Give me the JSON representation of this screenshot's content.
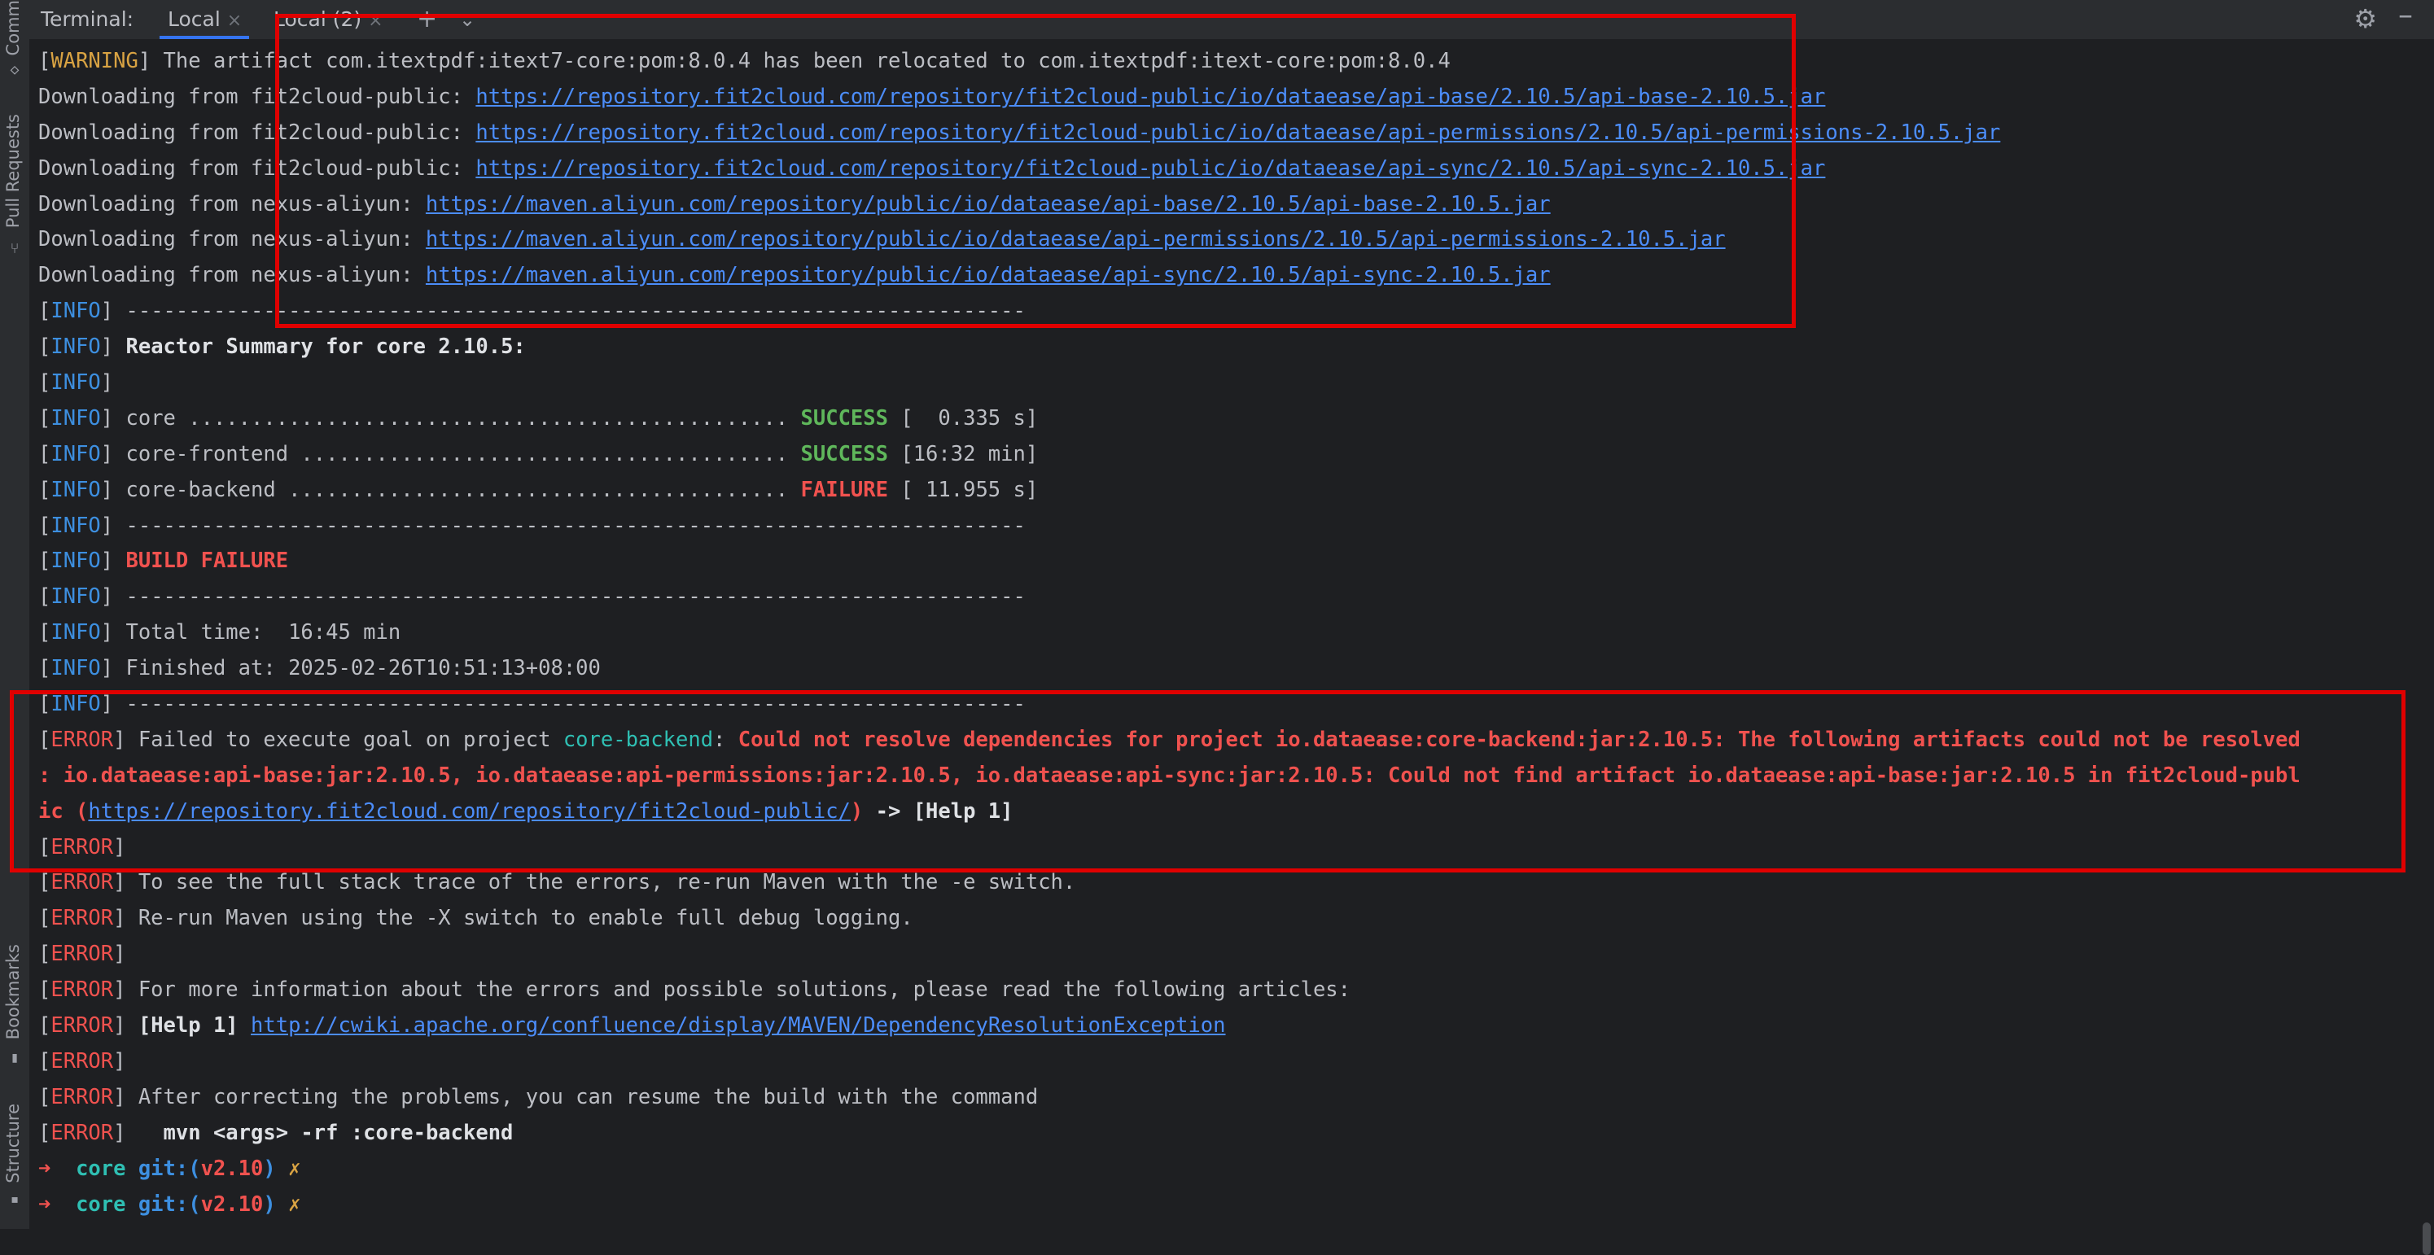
{
  "tabbar": {
    "label": "Terminal:",
    "tabs": [
      {
        "label": "Local",
        "active": true
      },
      {
        "label": "Local (2)",
        "active": false
      }
    ],
    "add_icon": "plus-icon",
    "menu_icon": "chevron-down-icon",
    "settings_icon": "gear-icon",
    "hide_icon": "minus-icon"
  },
  "left_strip": {
    "commit": "Comm",
    "pull_requests": "Pull Requests",
    "bookmarks": "Bookmarks",
    "structure": "Structure"
  },
  "terminal": {
    "lines": [
      [
        {
          "t": "[",
          "c": ""
        },
        {
          "t": "WARNING",
          "c": "c-warn"
        },
        {
          "t": "] The artifact com.itextpdf:itext7-core:pom:8.0.4 has been relocated to com.itextpdf:itext-core:pom:8.0.4",
          "c": ""
        }
      ],
      [
        {
          "t": "Downloading from fit2cloud-public: ",
          "c": ""
        },
        {
          "t": "https://repository.fit2cloud.com/repository/fit2cloud-public/io/dataease/api-base/2.10.5/api-base-2.10.5.jar",
          "c": "link"
        }
      ],
      [
        {
          "t": "Downloading from fit2cloud-public: ",
          "c": ""
        },
        {
          "t": "https://repository.fit2cloud.com/repository/fit2cloud-public/io/dataease/api-permissions/2.10.5/api-permissions-2.10.5.jar",
          "c": "link"
        }
      ],
      [
        {
          "t": "Downloading from fit2cloud-public: ",
          "c": ""
        },
        {
          "t": "https://repository.fit2cloud.com/repository/fit2cloud-public/io/dataease/api-sync/2.10.5/api-sync-2.10.5.jar",
          "c": "link"
        }
      ],
      [
        {
          "t": "Downloading from nexus-aliyun: ",
          "c": ""
        },
        {
          "t": "https://maven.aliyun.com/repository/public/io/dataease/api-base/2.10.5/api-base-2.10.5.jar",
          "c": "link"
        }
      ],
      [
        {
          "t": "Downloading from nexus-aliyun: ",
          "c": ""
        },
        {
          "t": "https://maven.aliyun.com/repository/public/io/dataease/api-permissions/2.10.5/api-permissions-2.10.5.jar",
          "c": "link"
        }
      ],
      [
        {
          "t": "Downloading from nexus-aliyun: ",
          "c": ""
        },
        {
          "t": "https://maven.aliyun.com/repository/public/io/dataease/api-sync/2.10.5/api-sync-2.10.5.jar",
          "c": "link"
        }
      ],
      [
        {
          "t": "[",
          "c": ""
        },
        {
          "t": "INFO",
          "c": "c-info"
        },
        {
          "t": "] ------------------------------------------------------------------------",
          "c": ""
        }
      ],
      [
        {
          "t": "[",
          "c": ""
        },
        {
          "t": "INFO",
          "c": "c-info"
        },
        {
          "t": "] ",
          "c": ""
        },
        {
          "t": "Reactor Summary for core 2.10.5:",
          "c": "c-bold"
        }
      ],
      [
        {
          "t": "[",
          "c": ""
        },
        {
          "t": "INFO",
          "c": "c-info"
        },
        {
          "t": "]",
          "c": ""
        }
      ],
      [
        {
          "t": "[",
          "c": ""
        },
        {
          "t": "INFO",
          "c": "c-info"
        },
        {
          "t": "] core ................................................ ",
          "c": ""
        },
        {
          "t": "SUCCESS",
          "c": "c-succ"
        },
        {
          "t": " [  0.335 s]",
          "c": ""
        }
      ],
      [
        {
          "t": "[",
          "c": ""
        },
        {
          "t": "INFO",
          "c": "c-info"
        },
        {
          "t": "] core-frontend ....................................... ",
          "c": ""
        },
        {
          "t": "SUCCESS",
          "c": "c-succ"
        },
        {
          "t": " [16:32 min]",
          "c": ""
        }
      ],
      [
        {
          "t": "[",
          "c": ""
        },
        {
          "t": "INFO",
          "c": "c-info"
        },
        {
          "t": "] core-backend ........................................ ",
          "c": ""
        },
        {
          "t": "FAILURE",
          "c": "c-fail"
        },
        {
          "t": " [ 11.955 s]",
          "c": ""
        }
      ],
      [
        {
          "t": "[",
          "c": ""
        },
        {
          "t": "INFO",
          "c": "c-info"
        },
        {
          "t": "] ------------------------------------------------------------------------",
          "c": ""
        }
      ],
      [
        {
          "t": "[",
          "c": ""
        },
        {
          "t": "INFO",
          "c": "c-info"
        },
        {
          "t": "] ",
          "c": ""
        },
        {
          "t": "BUILD FAILURE",
          "c": "c-errbold"
        }
      ],
      [
        {
          "t": "[",
          "c": ""
        },
        {
          "t": "INFO",
          "c": "c-info"
        },
        {
          "t": "] ------------------------------------------------------------------------",
          "c": ""
        }
      ],
      [
        {
          "t": "[",
          "c": ""
        },
        {
          "t": "INFO",
          "c": "c-info"
        },
        {
          "t": "] Total time:  16:45 min",
          "c": ""
        }
      ],
      [
        {
          "t": "[",
          "c": ""
        },
        {
          "t": "INFO",
          "c": "c-info"
        },
        {
          "t": "] Finished at: 2025-02-26T10:51:13+08:00",
          "c": ""
        }
      ],
      [
        {
          "t": "[",
          "c": ""
        },
        {
          "t": "INFO",
          "c": "c-info"
        },
        {
          "t": "] ------------------------------------------------------------------------",
          "c": ""
        }
      ],
      [
        {
          "t": "[",
          "c": ""
        },
        {
          "t": "ERROR",
          "c": "c-err"
        },
        {
          "t": "] Failed to execute goal on project ",
          "c": ""
        },
        {
          "t": "core-backend",
          "c": "c-mod"
        },
        {
          "t": ": ",
          "c": ""
        },
        {
          "t": "Could not resolve dependencies for project io.dataease:core-backend:jar:2.10.5: The following artifacts could not be resolved",
          "c": "c-errbold"
        }
      ],
      [
        {
          "t": ": io.dataease:api-base:jar:2.10.5, io.dataease:api-permissions:jar:2.10.5, io.dataease:api-sync:jar:2.10.5: Could not find artifact io.dataease:api-base:jar:2.10.5 in fit2cloud-publ",
          "c": "c-errbold"
        }
      ],
      [
        {
          "t": "ic (",
          "c": "c-errbold"
        },
        {
          "t": "https://repository.fit2cloud.com/repository/fit2cloud-public/",
          "c": "link"
        },
        {
          "t": ")",
          "c": "c-errbold"
        },
        {
          "t": " -> [Help 1]",
          "c": "c-bold"
        }
      ],
      [
        {
          "t": "[",
          "c": ""
        },
        {
          "t": "ERROR",
          "c": "c-err"
        },
        {
          "t": "]",
          "c": ""
        }
      ],
      [
        {
          "t": "[",
          "c": ""
        },
        {
          "t": "ERROR",
          "c": "c-err"
        },
        {
          "t": "] To see the full stack trace of the errors, re-run Maven with the -e switch.",
          "c": ""
        }
      ],
      [
        {
          "t": "[",
          "c": ""
        },
        {
          "t": "ERROR",
          "c": "c-err"
        },
        {
          "t": "] Re-run Maven using the -X switch to enable full debug logging.",
          "c": ""
        }
      ],
      [
        {
          "t": "[",
          "c": ""
        },
        {
          "t": "ERROR",
          "c": "c-err"
        },
        {
          "t": "]",
          "c": ""
        }
      ],
      [
        {
          "t": "[",
          "c": ""
        },
        {
          "t": "ERROR",
          "c": "c-err"
        },
        {
          "t": "] For more information about the errors and possible solutions, please read the following articles:",
          "c": ""
        }
      ],
      [
        {
          "t": "[",
          "c": ""
        },
        {
          "t": "ERROR",
          "c": "c-err"
        },
        {
          "t": "] ",
          "c": ""
        },
        {
          "t": "[Help 1]",
          "c": "c-bold"
        },
        {
          "t": " ",
          "c": ""
        },
        {
          "t": "http://cwiki.apache.org/confluence/display/MAVEN/DependencyResolutionException",
          "c": "link"
        }
      ],
      [
        {
          "t": "[",
          "c": ""
        },
        {
          "t": "ERROR",
          "c": "c-err"
        },
        {
          "t": "]",
          "c": ""
        }
      ],
      [
        {
          "t": "[",
          "c": ""
        },
        {
          "t": "ERROR",
          "c": "c-err"
        },
        {
          "t": "] After correcting the problems, you can resume the build with the command",
          "c": ""
        }
      ],
      [
        {
          "t": "[",
          "c": ""
        },
        {
          "t": "ERROR",
          "c": "c-err"
        },
        {
          "t": "]   ",
          "c": ""
        },
        {
          "t": "mvn <args> -rf :core-backend",
          "c": "c-bold"
        }
      ],
      [
        {
          "t": "➜  ",
          "c": "c-arrow"
        },
        {
          "t": "core ",
          "c": "c-dir"
        },
        {
          "t": "git:(",
          "c": "c-git"
        },
        {
          "t": "v2.10",
          "c": "c-branch"
        },
        {
          "t": ")",
          "c": "c-git"
        },
        {
          "t": " ✗",
          "c": "c-x"
        }
      ],
      [
        {
          "t": "➜  ",
          "c": "c-arrow"
        },
        {
          "t": "core ",
          "c": "c-dir"
        },
        {
          "t": "git:(",
          "c": "c-git"
        },
        {
          "t": "v2.10",
          "c": "c-branch"
        },
        {
          "t": ")",
          "c": "c-git"
        },
        {
          "t": " ✗",
          "c": "c-x"
        }
      ]
    ]
  },
  "colors": {
    "background": "#1e1f22",
    "info": "#3d8fe0",
    "warning": "#d9a343",
    "error": "#f0524f",
    "success": "#5fb75b",
    "link": "#4c8dfa",
    "highlight_box": "#e00000"
  }
}
